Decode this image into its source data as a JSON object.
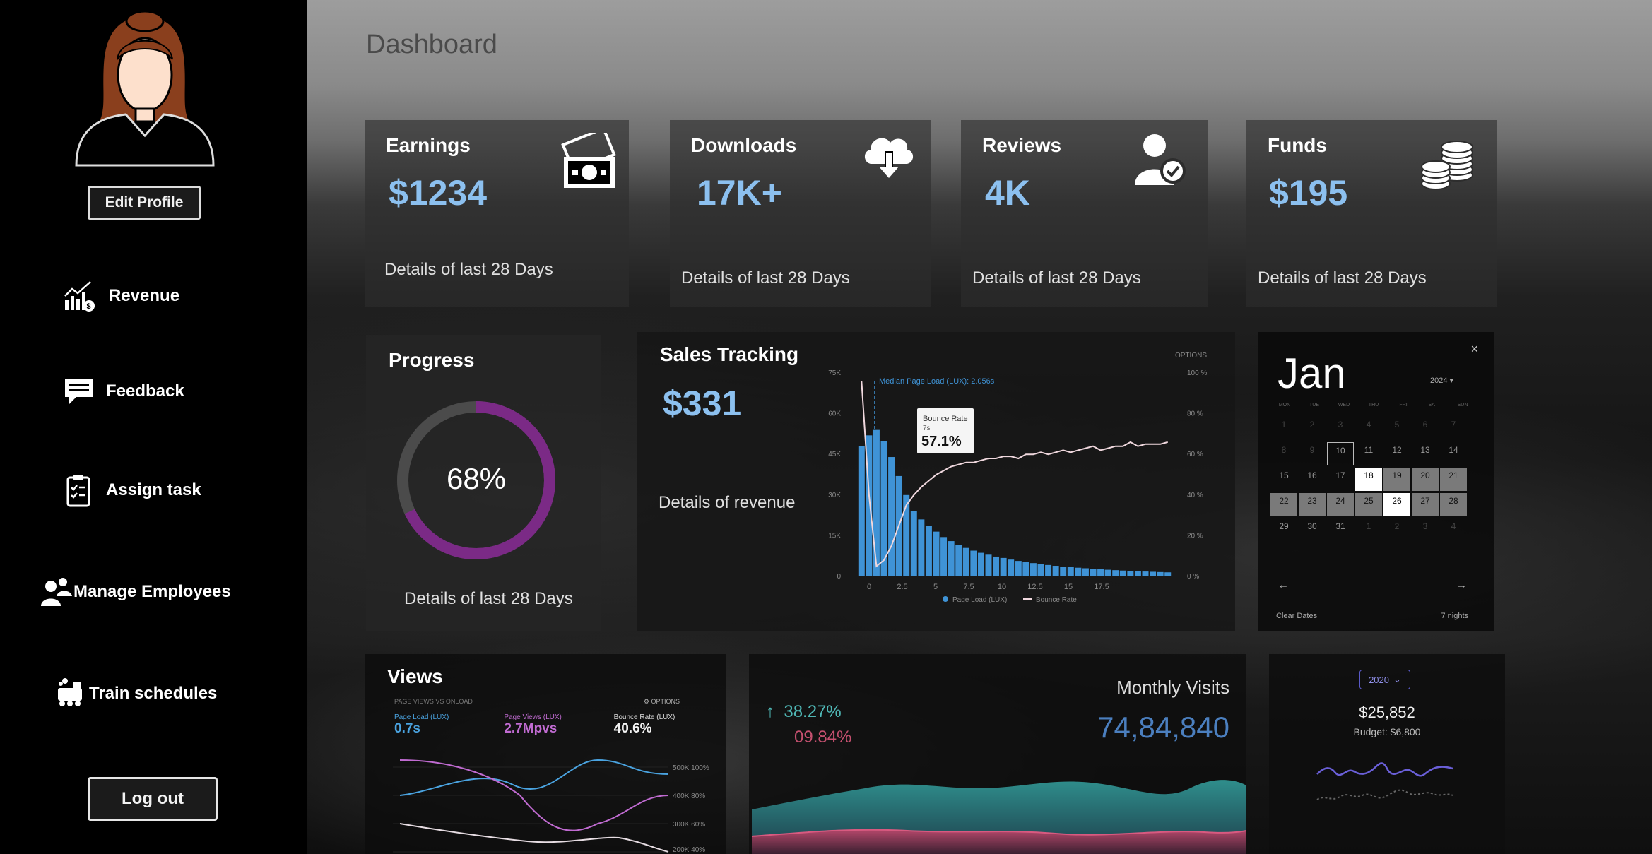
{
  "sidebar": {
    "edit_profile": "Edit Profile",
    "items": [
      {
        "label": "Revenue",
        "icon": "revenue-chart-icon"
      },
      {
        "label": "Feedback",
        "icon": "chat-bubble-icon"
      },
      {
        "label": "Assign task",
        "icon": "clipboard-icon"
      },
      {
        "label": "Manage Employees",
        "icon": "employees-icon"
      },
      {
        "label": "Train schedules",
        "icon": "train-icon"
      }
    ],
    "logout": "Log out"
  },
  "header": {
    "title": "Dashboard"
  },
  "stats": [
    {
      "title": "Earnings",
      "value": "$1234",
      "sub": "Details of last 28 Days",
      "icon": "cash-icon"
    },
    {
      "title": "Downloads",
      "value": "17K+",
      "sub": "Details of last 28 Days",
      "icon": "cloud-download-icon"
    },
    {
      "title": "Reviews",
      "value": "4K",
      "sub": "Details of last 28 Days",
      "icon": "user-check-icon"
    },
    {
      "title": "Funds",
      "value": "$195",
      "sub": "Details of last 28 Days",
      "icon": "coins-icon"
    }
  ],
  "progress": {
    "title": "Progress",
    "percent_label": "68%",
    "percent": 0.68,
    "sub": "Details of last 28 Days",
    "ring_color": "#7b2a86"
  },
  "sales": {
    "title": "Sales Tracking",
    "value": "$331",
    "sub": "Details of revenue",
    "options": "OPTIONS",
    "median_label": "Median Page Load (LUX): 2.056s",
    "tooltip": {
      "label": "Bounce Rate",
      "sub": "7s",
      "value": "57.1%"
    },
    "legend": [
      "Page Load (LUX)",
      "Bounce Rate"
    ]
  },
  "chart_data": {
    "type": "bar",
    "x_ticks": [
      "0",
      "2.5",
      "5",
      "7.5",
      "10",
      "12.5",
      "15",
      "17.5"
    ],
    "y_left_ticks": [
      "0",
      "15K",
      "30K",
      "45K",
      "60K",
      "75K"
    ],
    "y_right_ticks": [
      "0 %",
      "20 %",
      "40 %",
      "60 %",
      "80 %",
      "100 %"
    ],
    "series": [
      {
        "name": "Page Load (LUX)",
        "type": "bar",
        "color": "#3f93d6",
        "values": [
          48000,
          52000,
          54000,
          50000,
          44000,
          37000,
          30000,
          24000,
          21000,
          18500,
          16500,
          14500,
          13000,
          11500,
          10500,
          9500,
          8700,
          8000,
          7300,
          6800,
          6200,
          5700,
          5300,
          4900,
          4500,
          4200,
          3900,
          3600,
          3400,
          3200,
          3000,
          2800,
          2600,
          2450,
          2300,
          2150,
          2000,
          1900,
          1800,
          1700,
          1600,
          1500
        ]
      },
      {
        "name": "Bounce Rate",
        "type": "line",
        "color": "#f0d8de",
        "values": [
          96,
          40,
          5,
          8,
          15,
          25,
          35,
          40,
          44,
          47,
          50,
          52,
          54,
          55,
          56,
          56,
          57,
          58,
          58,
          59,
          59,
          58,
          60,
          60,
          61,
          60,
          61,
          62,
          61,
          62,
          63,
          64,
          62,
          63,
          64,
          64,
          66,
          64,
          65,
          65,
          65,
          66
        ]
      }
    ],
    "ylim_left": [
      0,
      75000
    ],
    "ylim_right": [
      0,
      100
    ]
  },
  "calendar": {
    "month": "Jan",
    "year": "2024 ▾",
    "close": "×",
    "weekdays": [
      "MON",
      "TUE",
      "WED",
      "THU",
      "FRI",
      "SAT",
      "SUN"
    ],
    "weeks": [
      [
        "1",
        "2",
        "3",
        "4",
        "5",
        "6",
        "7"
      ],
      [
        "8",
        "9",
        "10",
        "11",
        "12",
        "13",
        "14"
      ],
      [
        "15",
        "16",
        "17",
        "18",
        "19",
        "20",
        "21"
      ],
      [
        "22",
        "23",
        "24",
        "25",
        "26",
        "27",
        "28"
      ],
      [
        "29",
        "30",
        "31",
        "1",
        "2",
        "3",
        "4"
      ]
    ],
    "clear": "Clear Dates",
    "nights": "7 nights"
  },
  "views": {
    "title": "Views",
    "subtitle": "PAGE VIEWS VS ONLOAD",
    "options": "OPTIONS",
    "metrics": [
      {
        "label": "Page Load (LUX)",
        "value": "0.7s",
        "color": "#4aa3e0"
      },
      {
        "label": "Page Views (LUX)",
        "value": "2.7Mpvs",
        "color": "#c06bd1"
      },
      {
        "label": "Bounce Rate (LUX)",
        "value": "40.6%",
        "color": "#f2f2f2"
      }
    ],
    "right_ticks": [
      "500K 100%",
      "400K 80%",
      "300K 60%",
      "200K 40%"
    ]
  },
  "visits": {
    "title": "Monthly Visits",
    "value": "74,84,840",
    "up_pct": "38.27%",
    "down_pct": "09.84%"
  },
  "budget": {
    "year": "2020",
    "amount": "$25,852",
    "budget_label": "Budget: $6,800"
  }
}
